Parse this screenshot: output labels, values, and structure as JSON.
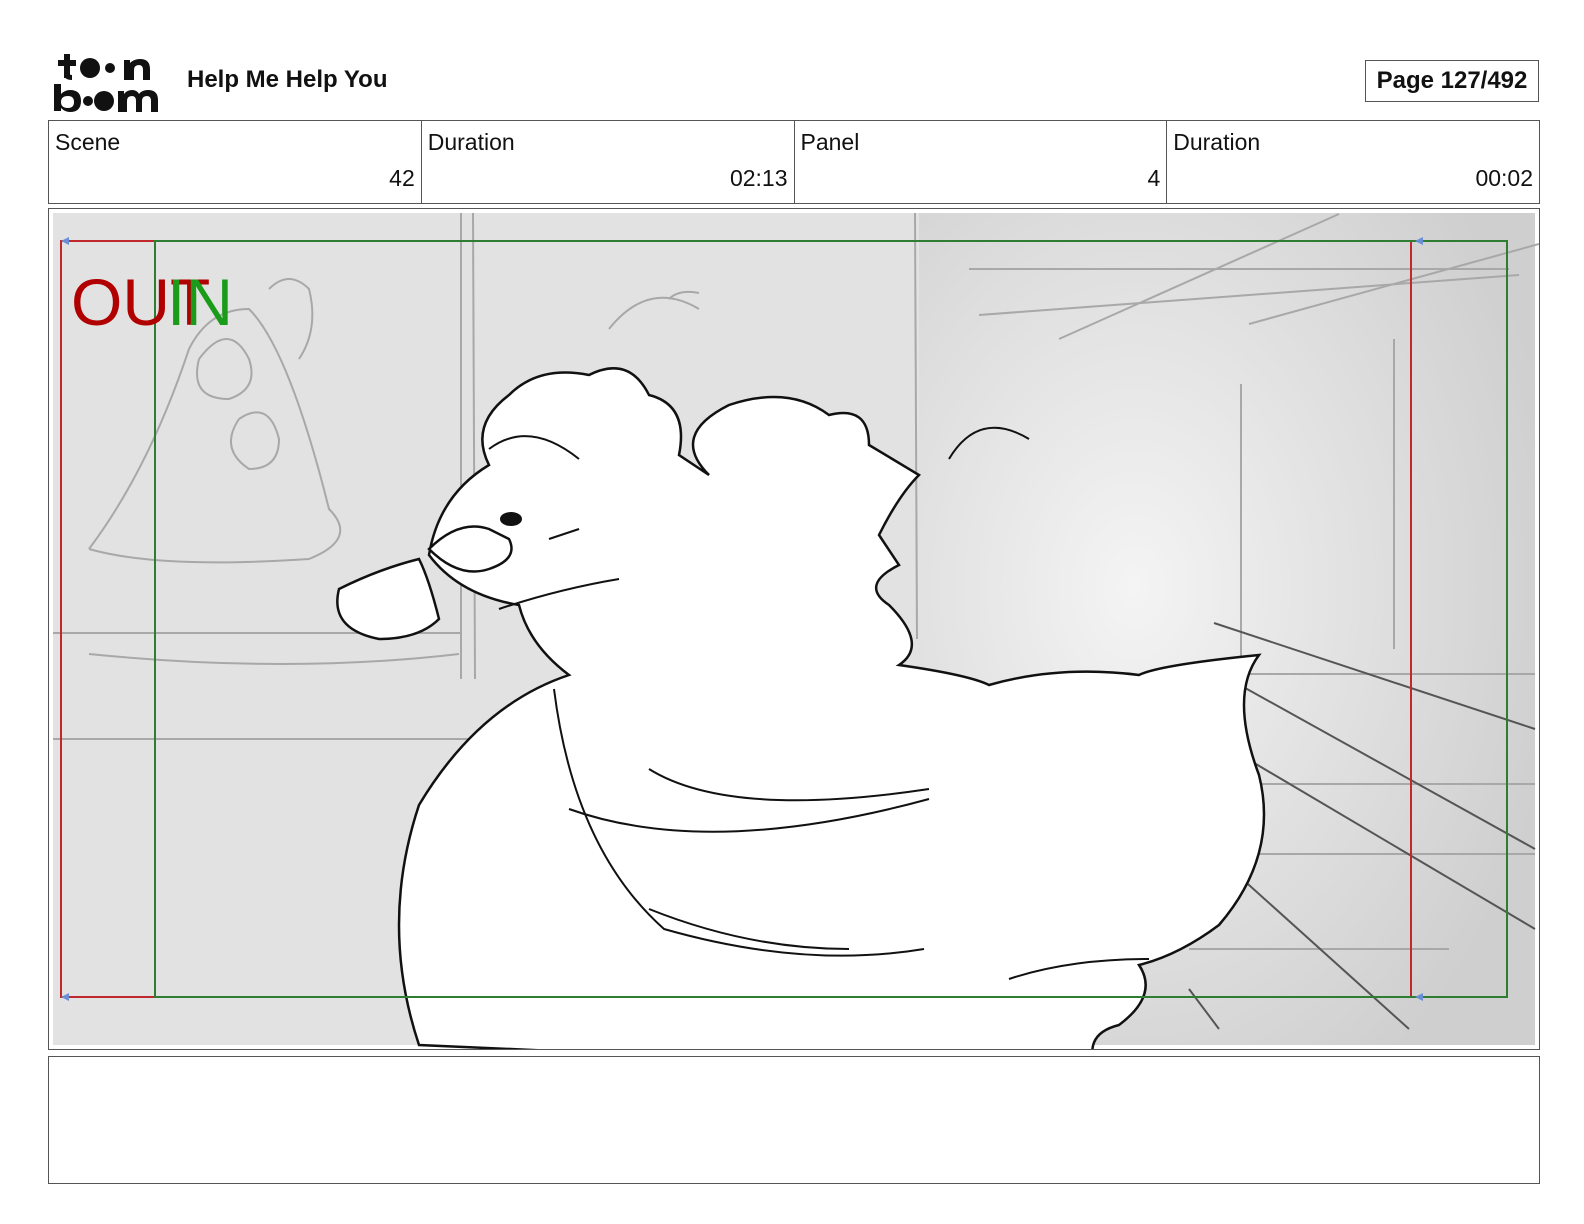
{
  "header": {
    "logo_line1": "to•n",
    "logo_line2": "b••m",
    "project_title": "Help Me Help You",
    "page_label": "Page 127/492"
  },
  "info": [
    {
      "label": "Scene",
      "value": "42"
    },
    {
      "label": "Duration",
      "value": "02:13"
    },
    {
      "label": "Panel",
      "value": "4"
    },
    {
      "label": "Duration",
      "value": "00:02"
    }
  ],
  "panel": {
    "out_label": "OUT",
    "in_label": "IN",
    "out_color": "#b00000",
    "in_color": "#1a9c1a",
    "frame_red": "#c0282e",
    "frame_green": "#2e7d32"
  },
  "notes": {
    "text": ""
  }
}
